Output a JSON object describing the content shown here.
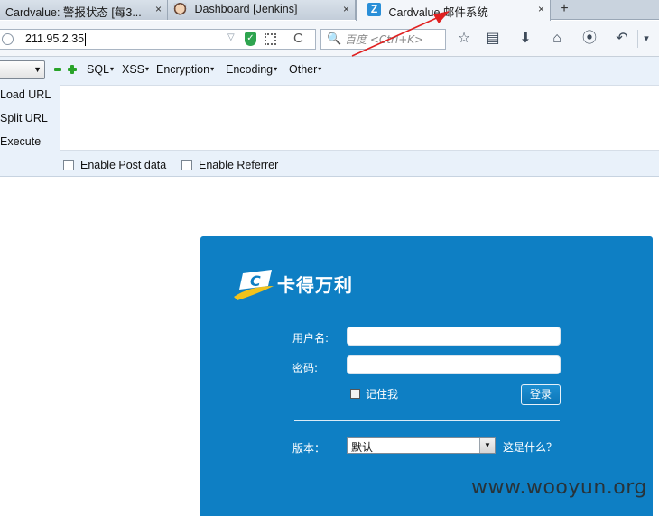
{
  "tabs": [
    {
      "title": "Cardvalue: 警报状态 [每3...",
      "close": "×"
    },
    {
      "title": "Dashboard [Jenkins]",
      "close": "×"
    },
    {
      "title": "Cardvalue 邮件系统",
      "favicon": "Z",
      "close": "×"
    }
  ],
  "new_tab": "+",
  "address_bar": {
    "url": "211.95.2.35",
    "dropdown_glyph": "▽",
    "security_icon": "green-shield-icon",
    "reload_glyph": "C"
  },
  "search_bar": {
    "placeholder": "百度 <Ctrl+K>",
    "icon": "🔍"
  },
  "nav_icons": {
    "bookmark": "☆",
    "reading_list": "▤",
    "download": "⬇",
    "home": "⌂",
    "sync": "⦿",
    "back": "↶",
    "menu": "▾"
  },
  "hackbar": {
    "select_value": "",
    "menus": [
      {
        "label": "SQL",
        "caret": "▾"
      },
      {
        "label": "XSS",
        "caret": "▾"
      },
      {
        "label": "Encryption",
        "caret": "▾"
      },
      {
        "label": "Encoding",
        "caret": "▾"
      },
      {
        "label": "Other",
        "caret": "▾"
      }
    ],
    "actions": [
      "Load URL",
      "Split URL",
      "Execute"
    ],
    "textarea_value": "",
    "checkboxes": [
      {
        "label": "Enable Post data",
        "checked": false
      },
      {
        "label": "Enable Referrer",
        "checked": false
      }
    ]
  },
  "login": {
    "logo_text": "卡得万利",
    "logo_letter": "C",
    "username_label": "用户名:",
    "password_label": "密码:",
    "username_value": "",
    "password_value": "",
    "remember_label": "记住我",
    "remember_checked": false,
    "login_button": "登录",
    "version_label": "版本：",
    "version_value": "默认",
    "what_is_this": "这是什么？"
  },
  "watermark": "www.wooyun.org",
  "colors": {
    "login_panel": "#0e7fc4",
    "tabstrip": "#c9d3de",
    "hackbar": "#e9f1fa",
    "arrow": "#e02020"
  }
}
